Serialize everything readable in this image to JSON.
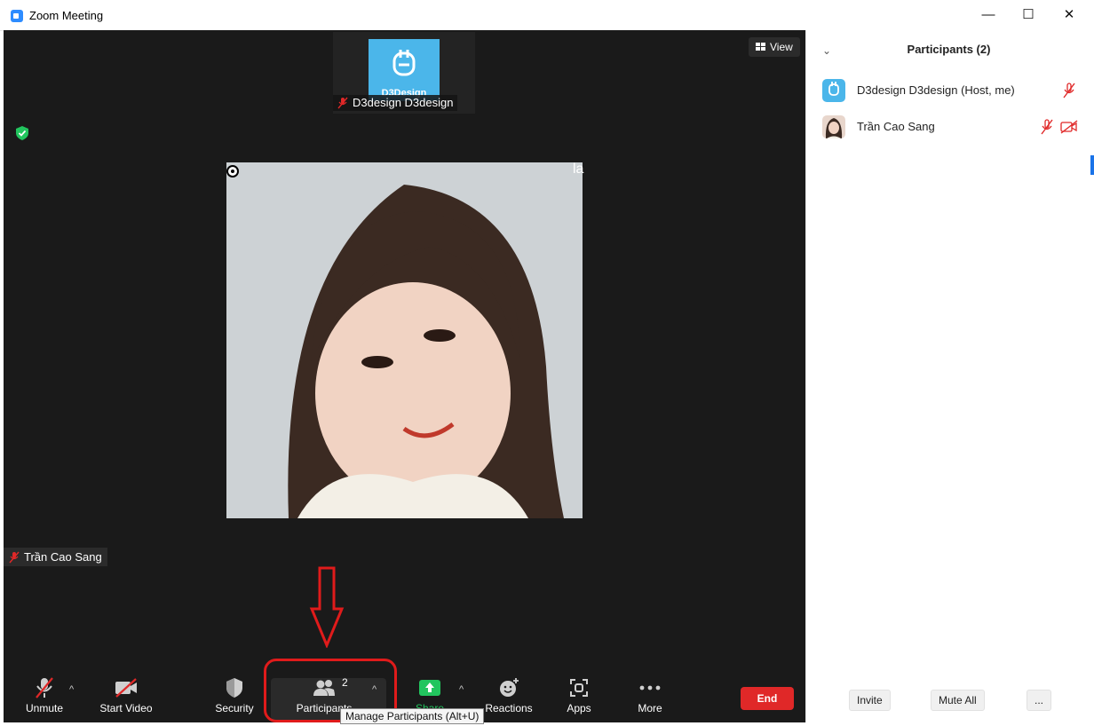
{
  "window": {
    "title": "Zoom Meeting",
    "minimize": "—",
    "maximize": "☐",
    "close": "✕"
  },
  "stage": {
    "thumbnail": {
      "logo_text": "D3Design",
      "name": "D3design D3design"
    },
    "view_button": "View",
    "overlay_char": "la",
    "speaker_name": "Trần Cao Sang"
  },
  "toolbar": {
    "unmute": "Unmute",
    "start_video": "Start Video",
    "security": "Security",
    "participants": "Participants",
    "participants_count": "2",
    "share": "Share",
    "reactions": "Reactions",
    "apps": "Apps",
    "more": "More",
    "end": "End",
    "tooltip": "Manage Participants (Alt+U)"
  },
  "panel": {
    "title": "Participants (2)",
    "participants": [
      {
        "name": "D3design D3design (Host, me)"
      },
      {
        "name": "Trần Cao Sang"
      }
    ],
    "invite": "Invite",
    "mute_all": "Mute All",
    "more": "..."
  },
  "colors": {
    "end": "#e02828",
    "highlight": "#e01b1b",
    "muted": "#e02828",
    "share": "#22c55e",
    "logo": "#4bb6ea"
  }
}
